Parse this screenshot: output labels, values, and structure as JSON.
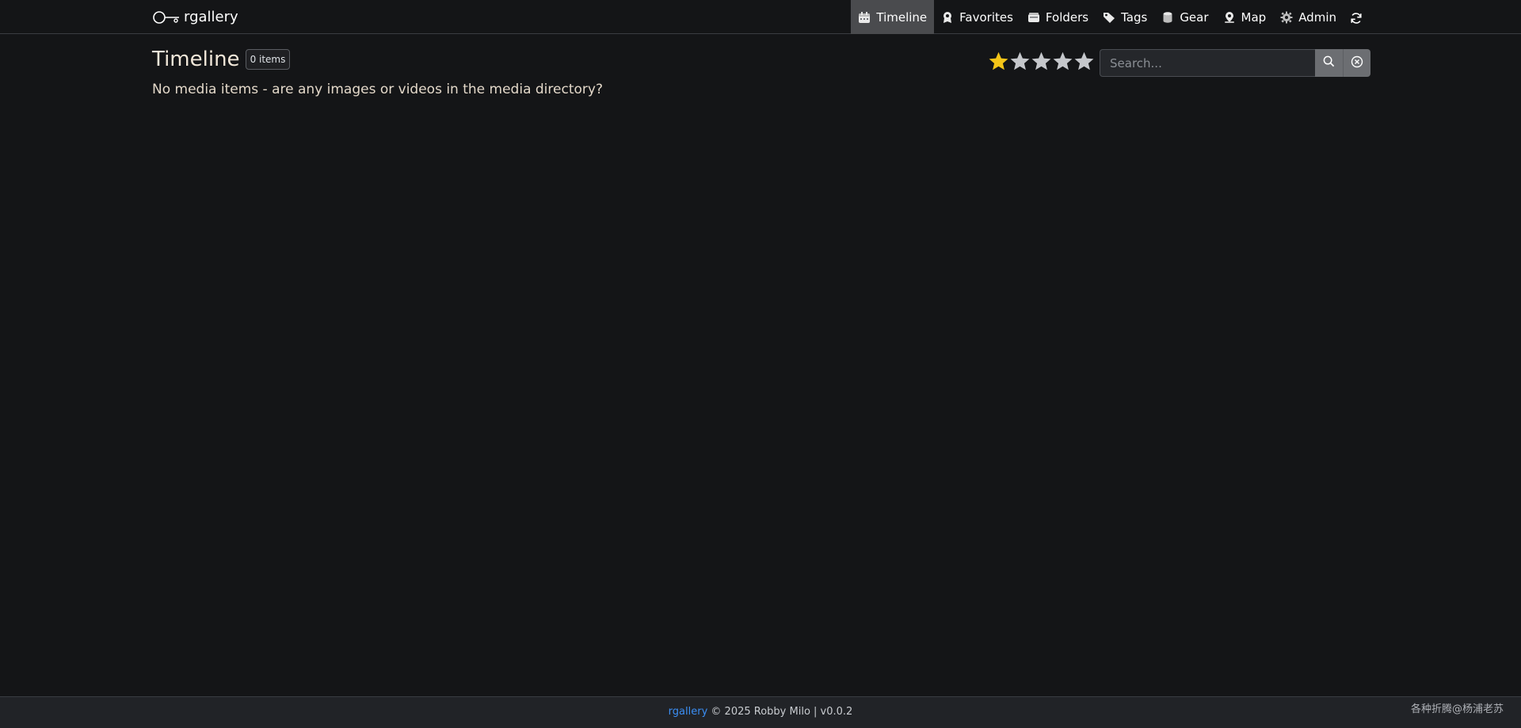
{
  "app": {
    "brand": "rgallery"
  },
  "nav": {
    "items": [
      {
        "label": "Timeline",
        "icon": "calendar-icon",
        "active": true
      },
      {
        "label": "Favorites",
        "icon": "award-icon",
        "active": false
      },
      {
        "label": "Folders",
        "icon": "folder-icon",
        "active": false
      },
      {
        "label": "Tags",
        "icon": "tags-icon",
        "active": false
      },
      {
        "label": "Gear",
        "icon": "database-icon",
        "active": false
      },
      {
        "label": "Map",
        "icon": "map-pin-icon",
        "active": false
      },
      {
        "label": "Admin",
        "icon": "gear-icon",
        "active": false
      }
    ],
    "refresh_icon": "refresh-icon"
  },
  "page": {
    "title": "Timeline",
    "count": "0 items",
    "empty_message": "No media items - are any images or videos in the media directory?"
  },
  "rating": {
    "selected": 1,
    "max": 5,
    "colors": {
      "filled": "#f5c518",
      "empty": "#c5c7cb"
    }
  },
  "search": {
    "placeholder": "Search...",
    "value": "",
    "search_icon": "search-icon",
    "clear_icon": "clear-icon"
  },
  "footer": {
    "link": "rgallery",
    "text": "© 2025 Robby Milo | v0.0.2"
  },
  "watermark": "各种折腾@杨浦老苏",
  "colors": {
    "background": "#141517",
    "active_nav": "#4a4b4e",
    "link": "#3b8ff5",
    "footer_bg": "#212327"
  }
}
